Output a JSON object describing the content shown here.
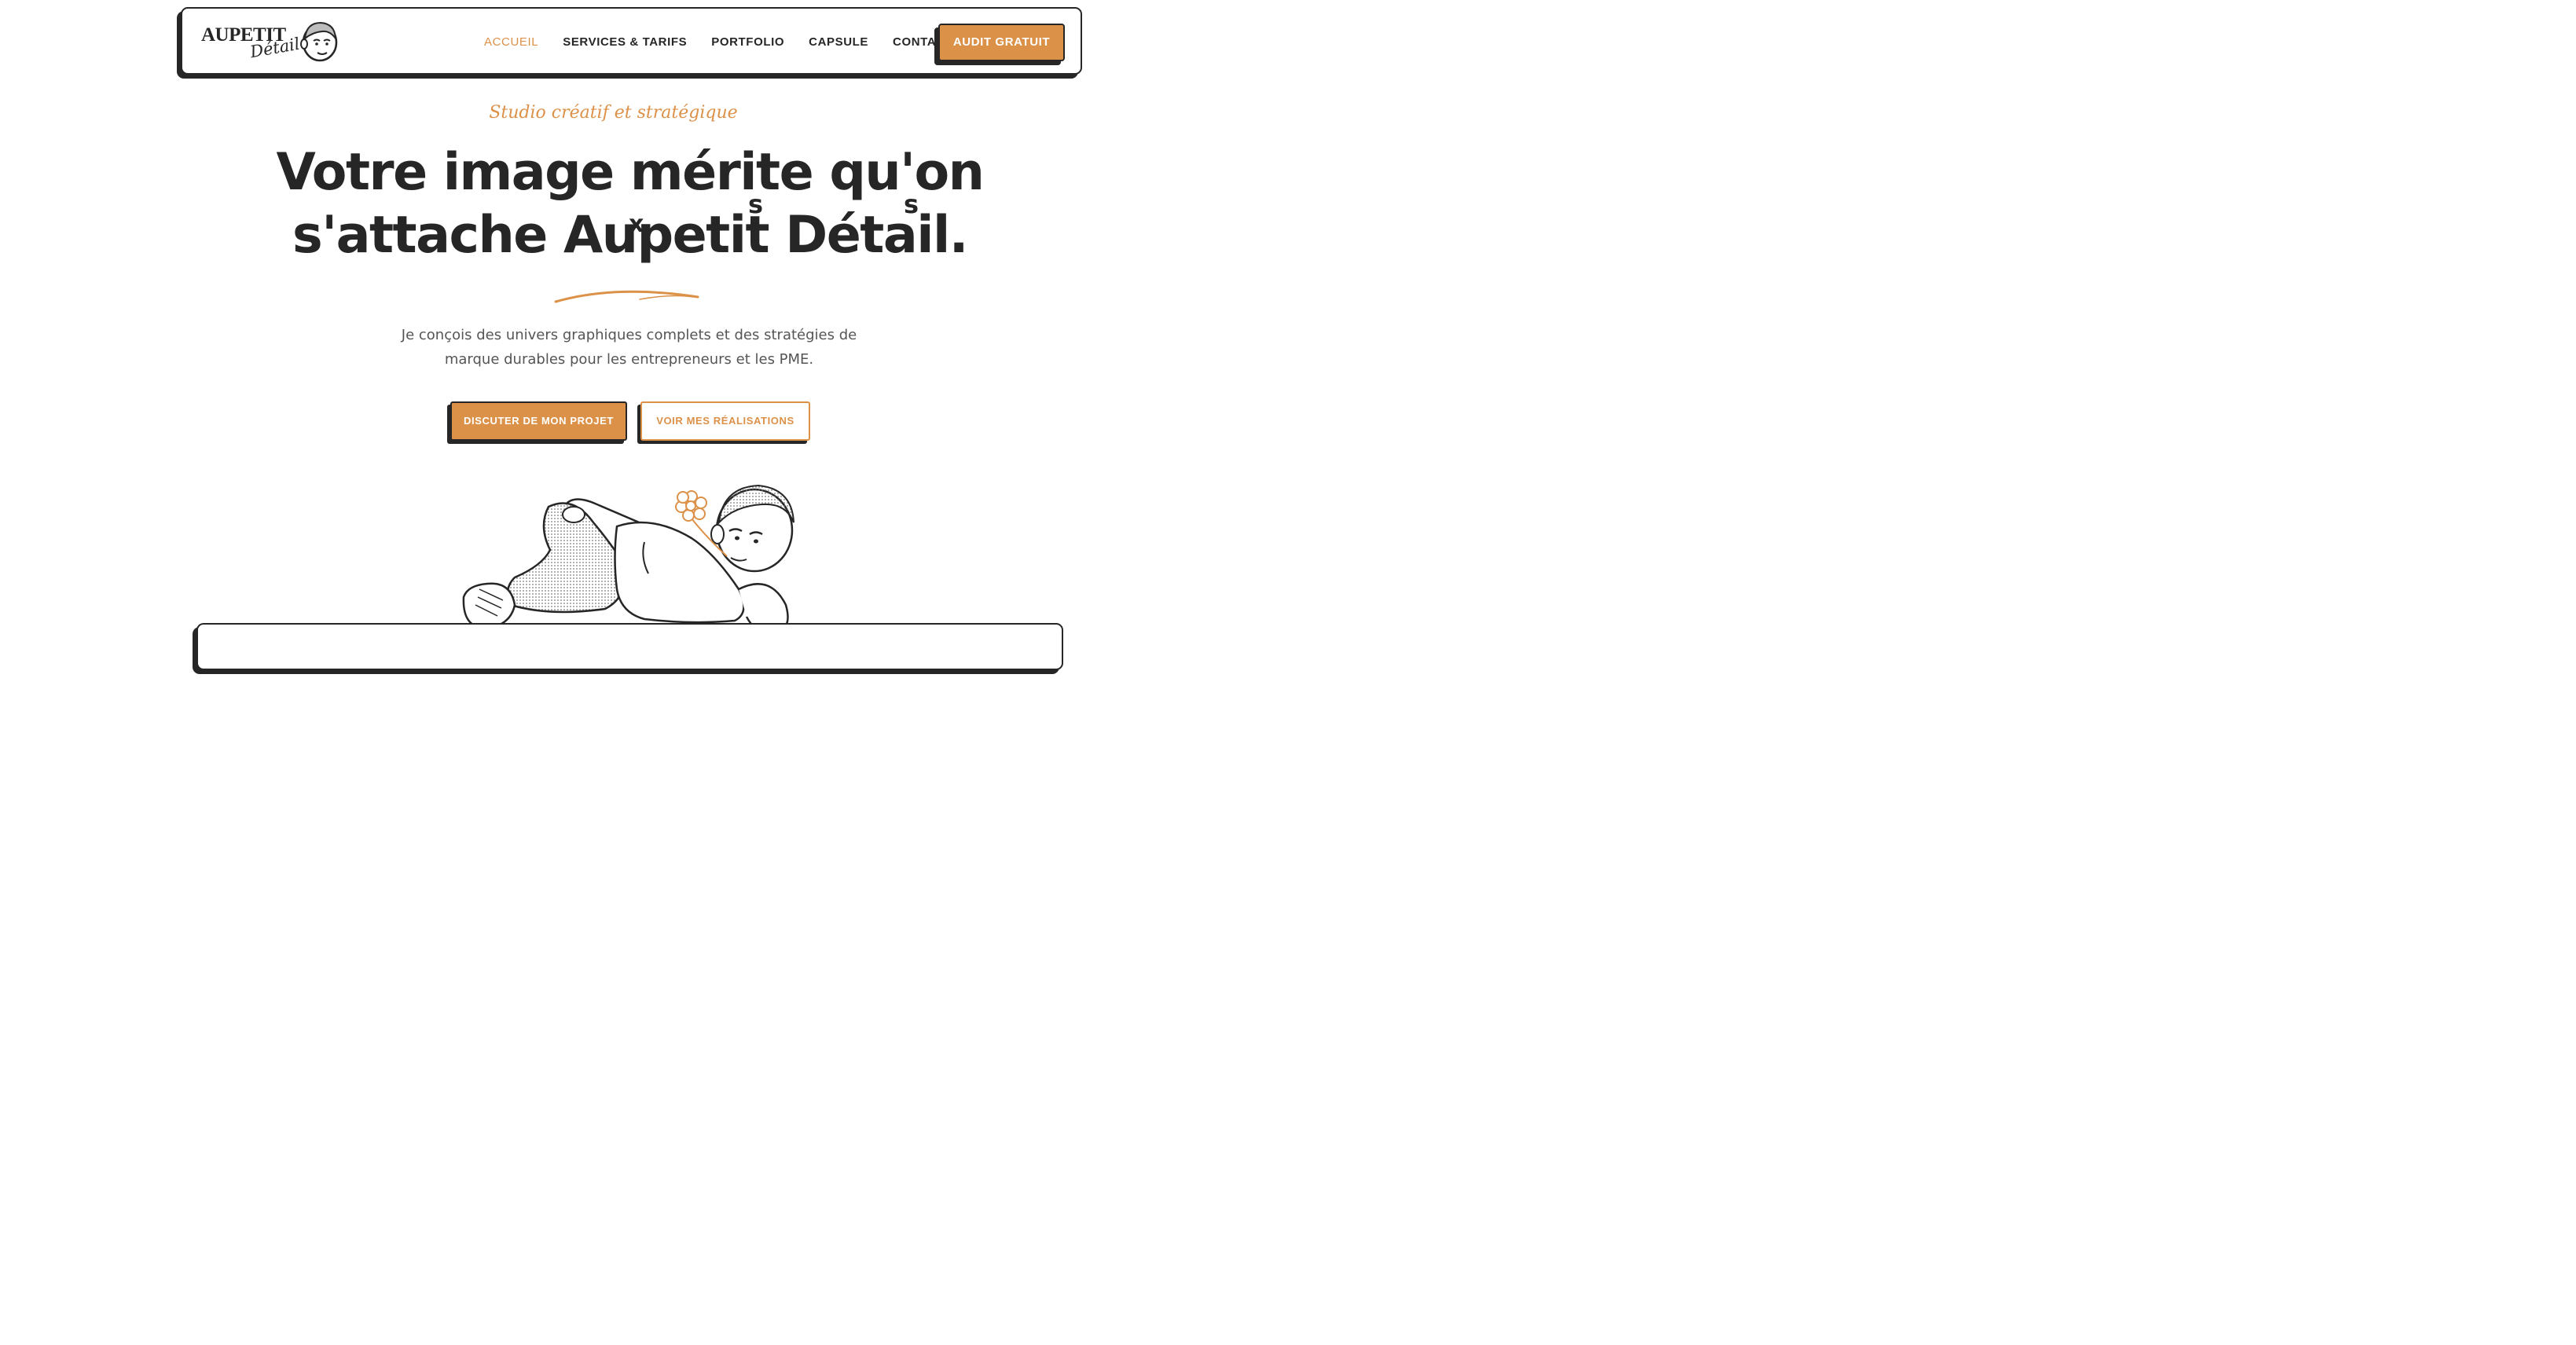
{
  "brand": {
    "logo_word": "AUPETIT",
    "logo_script": "Détail"
  },
  "nav": {
    "items": [
      {
        "label": "ACCUEIL",
        "active": true
      },
      {
        "label": "SERVICES & TARIFS",
        "active": false
      },
      {
        "label": "PORTFOLIO",
        "active": false
      },
      {
        "label": "CAPSULE",
        "active": false
      },
      {
        "label": "CONTACT",
        "active": false
      }
    ],
    "cta_label": "AUDIT GRATUIT"
  },
  "hero": {
    "tagline": "Studio créatif et stratégique",
    "headline_line1": "Votre image mérite qu'on",
    "headline_line2": "s'attache Aupetit Détail.",
    "correction_marks": [
      "x",
      "s",
      "s"
    ],
    "intro": "Je conçois des univers graphiques complets et des stratégies de marque durables pour les entrepreneurs et les PME.",
    "primary_button": "DISCUTER DE MON PROJET",
    "secondary_button": "VOIR MES RÉALISATIONS"
  },
  "colors": {
    "accent": "#dc9148",
    "ink": "#262626",
    "background": "#ffffff",
    "body_text": "#555555"
  },
  "icons": {
    "logo_mascot": "cartoon-boy-face-icon",
    "hero_illustration": "reclining-boy-with-flower-illustration"
  }
}
